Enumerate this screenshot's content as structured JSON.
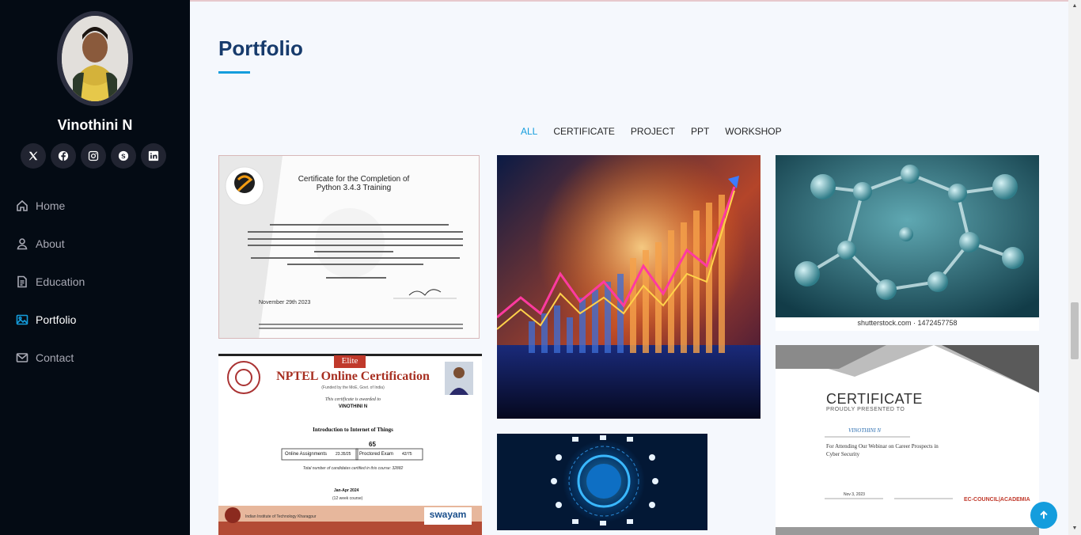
{
  "profile": {
    "name": "Vinothini N"
  },
  "socials": [
    {
      "icon": "x-icon"
    },
    {
      "icon": "facebook-icon"
    },
    {
      "icon": "instagram-icon"
    },
    {
      "icon": "skype-icon"
    },
    {
      "icon": "linkedin-icon"
    }
  ],
  "nav": {
    "home": "Home",
    "about": "About",
    "education": "Education",
    "portfolio": "Portfolio",
    "contact": "Contact"
  },
  "section": {
    "title": "Portfolio"
  },
  "filters": {
    "all": "ALL",
    "certificate": "CERTIFICATE",
    "project": "PROJECT",
    "ppt": "PPT",
    "workshop": "WORKSHOP"
  },
  "cert_python": {
    "title": "Certificate for the Completion of",
    "course": "Python 3.4.3 Training",
    "date": "November 29th 2023"
  },
  "cert_nptel": {
    "badge": "Elite",
    "title": "NPTEL Online Certification",
    "sub": "(Funded by the MoE, Govt. of India)",
    "awarded": "This certificate is awarded to",
    "name": "VINOTHINI N",
    "course": "Introduction to Internet of Things",
    "score": "65",
    "assign_label": "Online Assignments",
    "assign_val": "23.35/25",
    "exam_label": "Proctored Exam",
    "exam_val": "42/75",
    "candidates": "Total number of candidates certified in this course: 32882",
    "period": "Jan-Apr 2024",
    "weeks": "(12 week course)",
    "institute": "Indian Institute of Technology Kharagpur",
    "swayam": "swayam"
  },
  "molecule": {
    "caption": "shutterstock.com · 1472457758"
  },
  "cert_webinar": {
    "title": "CERTIFICATE",
    "sub": "PROUDLY PRESENTED TO",
    "name": "VINOTHINI N",
    "line1": "For Attending Our Webinar on Career Prospects in",
    "line2": "Cyber Security",
    "date": "Nov 3, 2023",
    "brand": "EC-COUNCIL|ACADEMIA"
  },
  "colors": {
    "accent": "#149ddd",
    "sidebar": "#040b14",
    "title": "#173b6c"
  }
}
